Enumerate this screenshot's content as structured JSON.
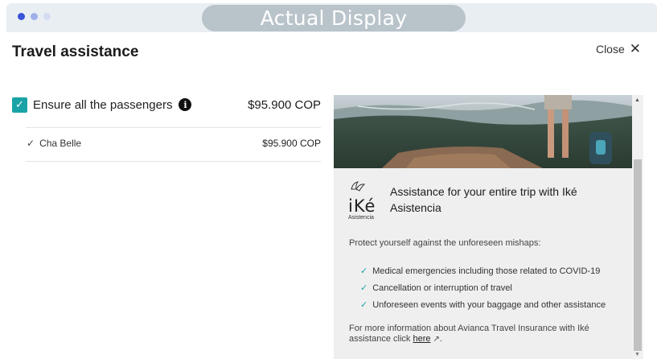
{
  "banner": {
    "text": "Actual Display"
  },
  "modal": {
    "title": "Travel assistance",
    "close_label": "Close",
    "close_icon": "×"
  },
  "summary": {
    "ensure_label": "Ensure all the passengers",
    "ensure_checked": true,
    "info_icon": "i",
    "total_price": "$95.900 COP",
    "passengers": [
      {
        "name": "Cha Belle",
        "price": "$95.900 COP",
        "selected": true
      }
    ]
  },
  "panel": {
    "logo": {
      "word": "iKé",
      "sub": "Asistencia"
    },
    "heading": "Assistance for your entire trip with Iké Asistencia",
    "protect_text": "Protect yourself against the unforeseen mishaps:",
    "benefits": [
      "Medical emergencies including those related to COVID-19",
      "Cancellation or interruption of travel",
      "Unforeseen events with your baggage and other assistance"
    ],
    "more_info_prefix": "For more information about Avianca Travel Insurance with Iké assistance click",
    "more_info_link": "here",
    "more_info_suffix": "."
  },
  "colors": {
    "accent": "#19a3a6",
    "pill": "#b9c3ca",
    "panel_bg": "#efefef"
  }
}
